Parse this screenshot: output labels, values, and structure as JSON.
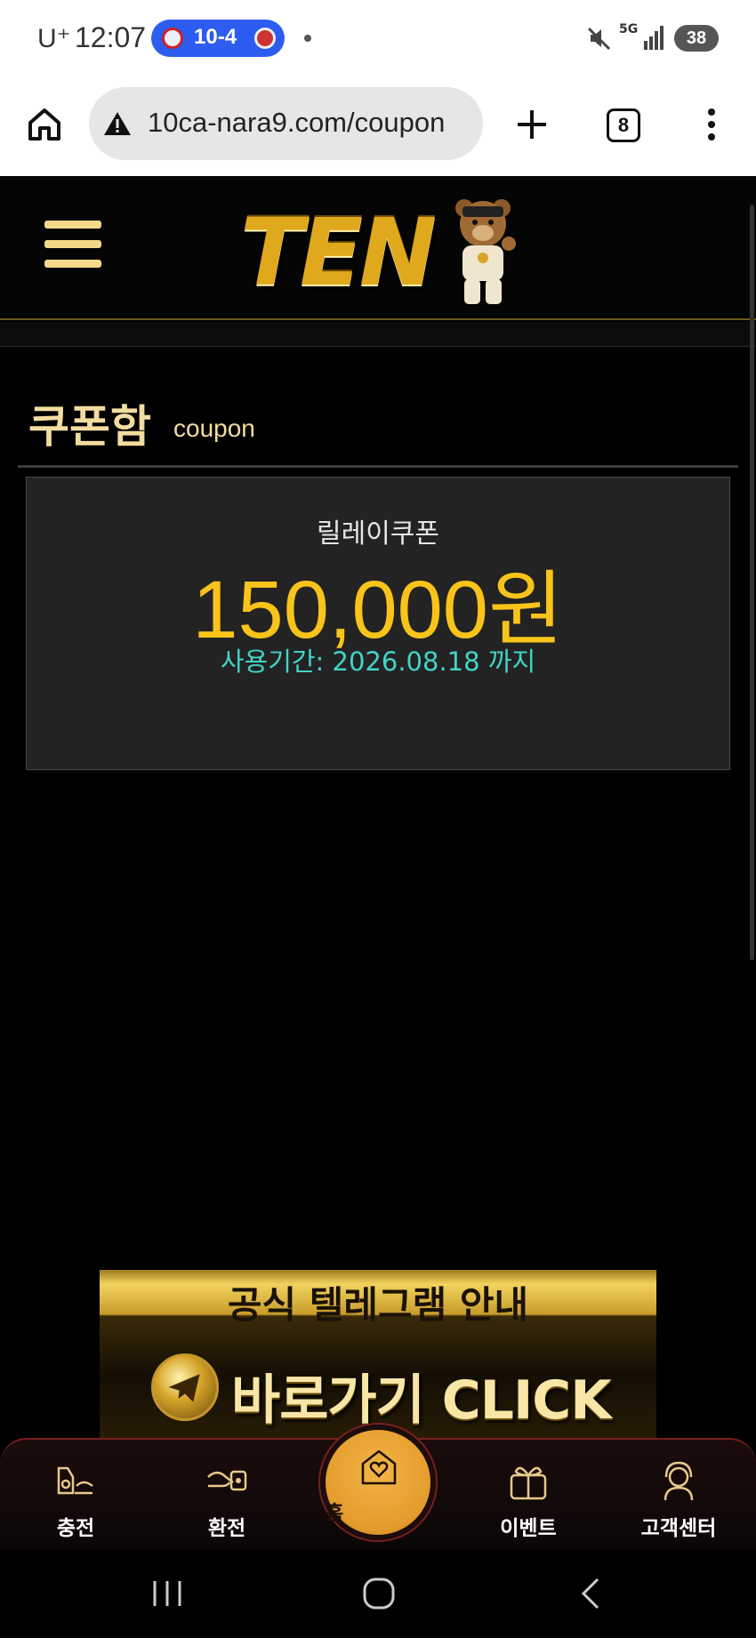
{
  "status_bar": {
    "carrier": "U⁺",
    "time": "12:07",
    "score": "10-4",
    "network": "5G",
    "battery": "38"
  },
  "browser": {
    "url": "10ca-nara9.com/coupon",
    "tab_count": "8"
  },
  "page": {
    "title": "쿠폰함",
    "subtitle": "coupon"
  },
  "coupon": {
    "name": "릴레이쿠폰",
    "amount": "150,000원",
    "expiry": "사용기간: 2026.08.18 까지"
  },
  "banner": {
    "title": "공식 텔레그램 안내",
    "cta": "바로가기 CLICK"
  },
  "bottom_nav": {
    "items": [
      {
        "label": "충전",
        "icon": "charge-icon"
      },
      {
        "label": "환전",
        "icon": "exchange-icon"
      },
      {
        "label": "홈",
        "icon": "home-heart-icon"
      },
      {
        "label": "이벤트",
        "icon": "gift-icon"
      },
      {
        "label": "고객센터",
        "icon": "support-icon"
      }
    ]
  },
  "colors": {
    "accent_gold": "#f8c41a",
    "title_gold": "#f3dca0",
    "expiry_teal": "#43d3c7",
    "home_orange": "#e39b2c"
  }
}
